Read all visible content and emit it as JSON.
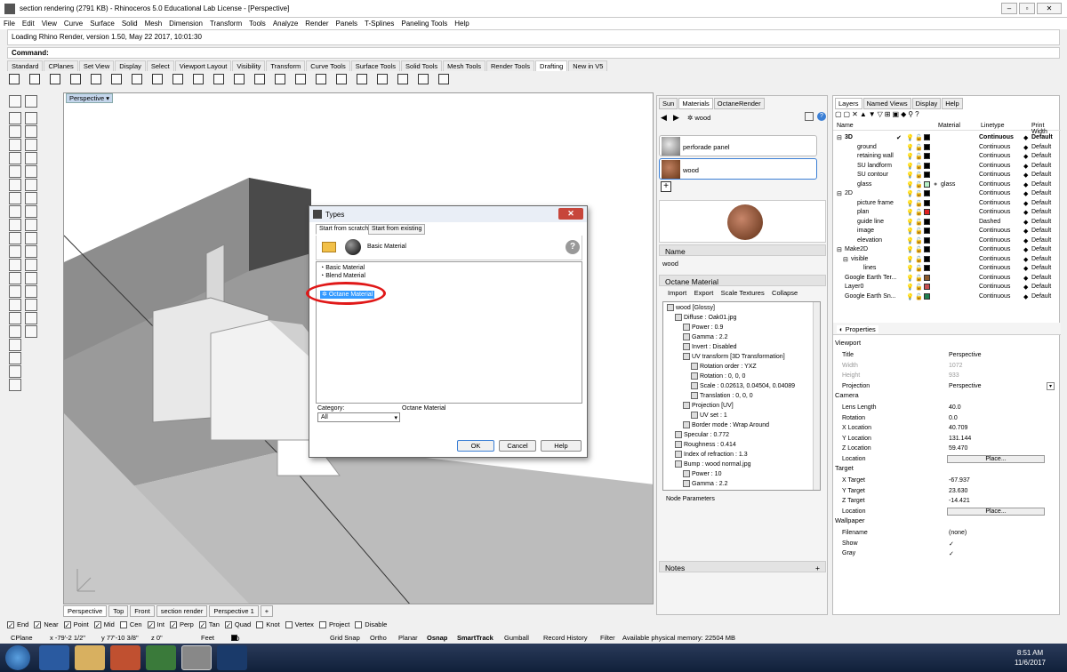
{
  "title": "section rendering (2791 KB) - Rhinoceros 5.0 Educational Lab License - [Perspective]",
  "window_controls": [
    "–",
    "▫",
    "✕"
  ],
  "menu": [
    "File",
    "Edit",
    "View",
    "Curve",
    "Surface",
    "Solid",
    "Mesh",
    "Dimension",
    "Transform",
    "Tools",
    "Analyze",
    "Render",
    "Panels",
    "T-Splines",
    "Paneling Tools",
    "Help"
  ],
  "history": "Loading Rhino Render, version 1.50, May 22 2017, 10:01:30",
  "command_label": "Command:",
  "toolbar_tabs": [
    "Standard",
    "CPlanes",
    "Set View",
    "Display",
    "Select",
    "Viewport Layout",
    "Visibility",
    "Transform",
    "Curve Tools",
    "Surface Tools",
    "Solid Tools",
    "Mesh Tools",
    "Render Tools",
    "Drafting",
    "New in V5"
  ],
  "active_toolbar_tab": "Drafting",
  "viewport": {
    "label": "Perspective",
    "tabs": [
      "Perspective",
      "Top",
      "Front",
      "section render",
      "Perspective 1"
    ],
    "add_tab": "+"
  },
  "osnaps": [
    {
      "label": "End",
      "checked": true
    },
    {
      "label": "Near",
      "checked": true
    },
    {
      "label": "Point",
      "checked": true
    },
    {
      "label": "Mid",
      "checked": true
    },
    {
      "label": "Cen",
      "checked": false
    },
    {
      "label": "Int",
      "checked": true
    },
    {
      "label": "Perp",
      "checked": true
    },
    {
      "label": "Tan",
      "checked": true
    },
    {
      "label": "Quad",
      "checked": true
    },
    {
      "label": "Knot",
      "checked": false
    },
    {
      "label": "Vertex",
      "checked": false
    },
    {
      "label": "Project",
      "checked": false
    },
    {
      "label": "Disable",
      "checked": false
    }
  ],
  "status": {
    "cplane": "CPlane",
    "x": "x -79'-2 1/2\"",
    "y": "y 77'-10 3/8\"",
    "z": "z 0\"",
    "units": "Feet",
    "layer": "3D",
    "grid_snap": "Grid Snap",
    "ortho": "Ortho",
    "planar": "Planar",
    "osnap": "Osnap",
    "smarttrack": "SmartTrack",
    "gumball": "Gumball",
    "record_history": "Record History",
    "filter": "Filter",
    "memory": "Available physical memory: 22504 MB"
  },
  "clock": {
    "time": "8:51 AM",
    "date": "11/6/2017"
  },
  "materials_panel": {
    "tabs": [
      "Sun",
      "Materials",
      "OctaneRender"
    ],
    "breadcrumb": "wood",
    "materials": [
      "perforade panel",
      "wood"
    ],
    "selected": "wood",
    "add": "+",
    "name_header": "Name",
    "name_value": "wood",
    "octane_header": "Octane Material",
    "octane_tabs": [
      "Import",
      "Export",
      "Scale Textures",
      "Collapse"
    ],
    "tree": [
      "wood  [Glossy]",
      "Diffuse : Oak01.jpg",
      "Power : 0.9",
      "Gamma : 2.2",
      "Invert : Disabled",
      "UV transform  [3D Transformation]",
      "Rotation order : YXZ",
      "Rotation : 0, 0, 0",
      "Scale : 0.02613, 0.04504, 0.04089",
      "Translation : 0, 0, 0",
      "Projection  [UV]",
      "UV set : 1",
      "Border mode : Wrap Around",
      "Specular : 0.772",
      "Roughness : 0.414",
      "Index of refraction : 1.3",
      "Bump : wood normal.jpg",
      "Power : 10",
      "Gamma : 2.2"
    ],
    "node_params": "Node Parameters",
    "notes": "Notes",
    "notes_add": "+"
  },
  "layers_panel": {
    "tabs": [
      "Layers",
      "Named Views",
      "Display",
      "Help"
    ],
    "columns": [
      "Name",
      "Material",
      "Linetype",
      "Print Width"
    ],
    "rows": [
      {
        "name": "3D",
        "indent": 0,
        "expander": "⊟",
        "current": "✔",
        "color": "#000000",
        "material": "",
        "linetype": "Continuous",
        "print": "Default",
        "bold": true
      },
      {
        "name": "ground",
        "indent": 2,
        "color": "#000000",
        "material": "",
        "linetype": "Continuous",
        "print": "Default"
      },
      {
        "name": "retaining wall",
        "indent": 2,
        "color": "#000000",
        "material": "",
        "linetype": "Continuous",
        "print": "Default"
      },
      {
        "name": "SU landform",
        "indent": 2,
        "color": "#000000",
        "material": "",
        "linetype": "Continuous",
        "print": "Default"
      },
      {
        "name": "SU contour",
        "indent": 2,
        "color": "#000000",
        "material": "",
        "linetype": "Continuous",
        "print": "Default"
      },
      {
        "name": "glass",
        "indent": 2,
        "color": "#b8f0c8",
        "material": "glass",
        "linetype": "Continuous",
        "print": "Default"
      },
      {
        "name": "2D",
        "indent": 0,
        "expander": "⊟",
        "color": "#000000",
        "material": "",
        "linetype": "Continuous",
        "print": "Default"
      },
      {
        "name": "picture frame",
        "indent": 2,
        "color": "#000000",
        "material": "",
        "linetype": "Continuous",
        "print": "Default"
      },
      {
        "name": "plan",
        "indent": 2,
        "color": "#e02020",
        "material": "",
        "linetype": "Continuous",
        "print": "Default"
      },
      {
        "name": "guide line",
        "indent": 2,
        "color": "#000000",
        "material": "",
        "linetype": "Dashed",
        "print": "Default"
      },
      {
        "name": "image",
        "indent": 2,
        "color": "#000000",
        "material": "",
        "linetype": "Continuous",
        "print": "Default"
      },
      {
        "name": "elevation",
        "indent": 2,
        "color": "#000000",
        "material": "",
        "linetype": "Continuous",
        "print": "Default"
      },
      {
        "name": "Make2D",
        "indent": 0,
        "expander": "⊟",
        "color": "#000000",
        "material": "",
        "linetype": "Continuous",
        "print": "Default"
      },
      {
        "name": "visible",
        "indent": 1,
        "expander": "⊟",
        "color": "#000000",
        "material": "",
        "linetype": "Continuous",
        "print": "Default"
      },
      {
        "name": "lines",
        "indent": 3,
        "color": "#000000",
        "material": "",
        "linetype": "Continuous",
        "print": "Default"
      },
      {
        "name": "Google Earth Ter...",
        "indent": 0,
        "color": "#8b5a2b",
        "material": "",
        "linetype": "Continuous",
        "print": "Default"
      },
      {
        "name": "Layer0",
        "indent": 0,
        "color": "#c85050",
        "material": "",
        "linetype": "Continuous",
        "print": "Default"
      },
      {
        "name": "Google Earth Sn...",
        "indent": 0,
        "color": "#208050",
        "material": "",
        "linetype": "Continuous",
        "print": "Default"
      }
    ]
  },
  "properties_panel": {
    "tab": "Properties",
    "sections": [
      {
        "title": "Viewport",
        "rows": [
          {
            "k": "Title",
            "v": "Perspective"
          },
          {
            "k": "Width",
            "v": "1072",
            "disabled": true
          },
          {
            "k": "Height",
            "v": "933",
            "disabled": true
          },
          {
            "k": "Projection",
            "v": "Perspective",
            "dropdown": true
          }
        ]
      },
      {
        "title": "Camera",
        "rows": [
          {
            "k": "Lens Length",
            "v": "40.0"
          },
          {
            "k": "Rotation",
            "v": "0.0"
          },
          {
            "k": "X Location",
            "v": "40.709"
          },
          {
            "k": "Y Location",
            "v": "131.144"
          },
          {
            "k": "Z Location",
            "v": "59.470"
          },
          {
            "k": "Location",
            "v": "Place...",
            "button": true
          }
        ]
      },
      {
        "title": "Target",
        "rows": [
          {
            "k": "X Target",
            "v": "-67.937"
          },
          {
            "k": "Y Target",
            "v": "23.630"
          },
          {
            "k": "Z Target",
            "v": "-14.421"
          },
          {
            "k": "Location",
            "v": "Place...",
            "button": true
          }
        ]
      },
      {
        "title": "Wallpaper",
        "rows": [
          {
            "k": "Filename",
            "v": "(none)"
          },
          {
            "k": "Show",
            "v": "✓"
          },
          {
            "k": "Gray",
            "v": "✓"
          }
        ]
      }
    ]
  },
  "dialog": {
    "title": "Types",
    "tabs": [
      "Start from scratch",
      "Start from existing"
    ],
    "header_label": "Basic Material",
    "help": "?",
    "items": [
      "Basic Material",
      "Blend Material",
      "Octane Material"
    ],
    "selected": "Octane Material",
    "category_label": "Category:",
    "category_value": "All",
    "selected_name": "Octane Material",
    "ok": "OK",
    "cancel": "Cancel",
    "help_btn": "Help",
    "close": "✕"
  },
  "colors": {
    "accent": "#3b7fd5",
    "highlight_ring": "#e01818",
    "taskbar": "#1a2a48"
  }
}
